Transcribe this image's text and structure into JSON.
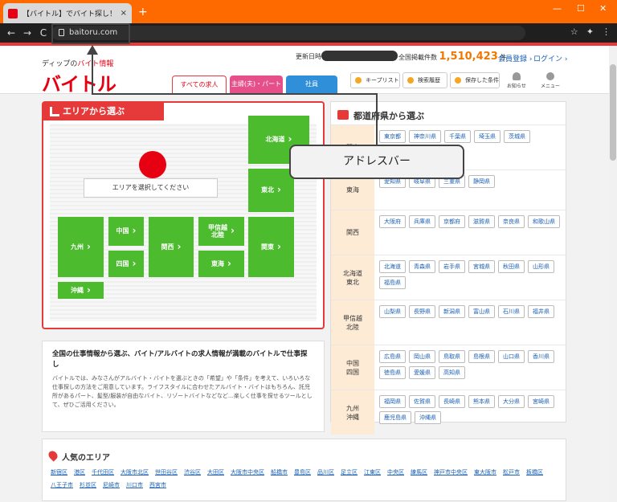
{
  "browser": {
    "tab_title": "【バイトル】でバイト探し！アルバイト・",
    "tab_close": "×",
    "new_tab": "+",
    "url": "baitoru.com",
    "back": "←",
    "forward": "→",
    "reload": "C",
    "minimize": "—",
    "maximize": "☐",
    "close": "✕",
    "star": "☆",
    "ext": "✦",
    "menu": "⋮"
  },
  "header": {
    "tagline_prefix": "ディップの",
    "tagline_em": "バイト情報",
    "logo": "バイトル",
    "updated_label": "更新日時",
    "count_label": "全国掲載件数",
    "count_value": "1,510,423",
    "count_unit": "件",
    "register": "会員登録 ›",
    "login": "ログイン ›",
    "tabs": [
      "すべての求人",
      "主婦(夫)・パート",
      "社員"
    ],
    "buttons": [
      "キープリスト",
      "検索履歴",
      "保存した条件"
    ],
    "notice": "お知らせ",
    "menu": "メニュー"
  },
  "colors": {
    "accent": "#e60012",
    "region_green": "#4cbb2e",
    "highlight_yellow": "#f07800"
  },
  "area": {
    "title": "エリアから選ぶ",
    "prompt": "エリアを選択してください",
    "regions": {
      "hokkaido": "北海道",
      "tohoku": "東北",
      "kyushu": "九州",
      "chugoku": "中国",
      "shikoku": "四国",
      "kansai": "関西",
      "koshinetsu": "甲信越\n北陸",
      "tokai": "東海",
      "kanto": "関東",
      "okinawa": "沖縄"
    }
  },
  "prefectures": {
    "title": "都道府県から選ぶ",
    "rows": [
      {
        "region": "関東",
        "items": [
          "東京都",
          "神奈川県",
          "千葉県",
          "埼玉県",
          "茨城県"
        ]
      },
      {
        "region": "東海",
        "items": [
          "愛知県",
          "岐阜県",
          "三重県",
          "静岡県"
        ]
      },
      {
        "region": "関西",
        "items": [
          "大阪府",
          "兵庫県",
          "京都府",
          "滋賀県",
          "奈良県",
          "和歌山県"
        ]
      },
      {
        "region": "北海道\n東北",
        "items": [
          "北海道",
          "青森県",
          "岩手県",
          "宮城県",
          "秋田県",
          "山形県",
          "福島県"
        ]
      },
      {
        "region": "甲信越\n北陸",
        "items": [
          "山梨県",
          "長野県",
          "新潟県",
          "富山県",
          "石川県",
          "福井県"
        ]
      },
      {
        "region": "中国\n四国",
        "items": [
          "広島県",
          "岡山県",
          "鳥取県",
          "島根県",
          "山口県",
          "香川県",
          "徳島県",
          "愛媛県",
          "高知県"
        ]
      },
      {
        "region": "九州\n沖縄",
        "items": [
          "福岡県",
          "佐賀県",
          "長崎県",
          "熊本県",
          "大分県",
          "宮崎県",
          "鹿児島県",
          "沖縄県"
        ]
      }
    ]
  },
  "intro": {
    "heading": "全国の仕事情報から選ぶ、バイト/アルバイトの求人情報が満載のバイトルで仕事探し",
    "body": "バイトルでは、みなさんがアルバイト・バイトを選ぶときの「希望」や「条件」を考えて、いろいろな仕事探しの方法をご用意しています。ライフスタイルに合わせたアルバイト・バイトはもちろん、託児所があるパート、髪型/服装が自由なバイト、リゾートバイトなどなど…楽しく仕事を探せるツールとして、ぜひご活用ください。"
  },
  "popular": {
    "title": "人気のエリア",
    "links": [
      "新宿区",
      "港区",
      "千代田区",
      "大阪市北区",
      "世田谷区",
      "渋谷区",
      "大田区",
      "大阪市中央区",
      "船橋市",
      "豊島区",
      "品川区",
      "足立区",
      "江東区",
      "中央区",
      "練馬区",
      "神戸市中央区",
      "東大阪市",
      "松戸市",
      "板橋区",
      "八王子市",
      "杉並区",
      "尼崎市",
      "川口市",
      "西宮市"
    ]
  },
  "callout": {
    "label": "アドレスバー"
  }
}
